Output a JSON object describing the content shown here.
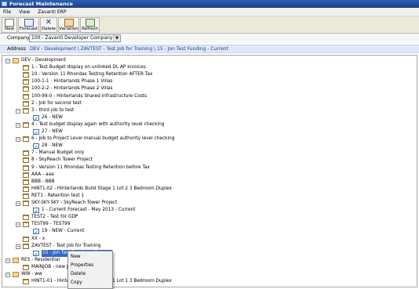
{
  "window": {
    "title": "Forecast Maintenance"
  },
  "menu": {
    "items": [
      "File",
      "View",
      "Zavanti ERP"
    ]
  },
  "toolbar": {
    "new": "New",
    "forecast": "Forecast",
    "delete": "Delete",
    "variation": "Variation",
    "refresh": "Refresh"
  },
  "company": {
    "label": "Company",
    "value": "100 - Zavanti Developer Company"
  },
  "address": {
    "label": "Address",
    "value": "DEV - Development \\ ZAVTEST - Test Job for Training \\ 15 - Jon Test Funding - Current"
  },
  "tree": [
    {
      "text": "DEV - Development",
      "level": 0,
      "exp": "-",
      "icon": "folder"
    },
    {
      "text": "1 - Test Budget display on unlinked DL AP invoices",
      "level": 1,
      "exp": "",
      "icon": "doc"
    },
    {
      "text": "10 - Version 11 Rhondas Testing Retention AFTER Tax",
      "level": 1,
      "exp": "",
      "icon": "doc"
    },
    {
      "text": "100-1-1 - Hinterlands Phase 1 Villas",
      "level": 1,
      "exp": "",
      "icon": "doc"
    },
    {
      "text": "100-2-2 - Hinterlands Phase 2 Villas",
      "level": 1,
      "exp": "",
      "icon": "doc"
    },
    {
      "text": "100-99-0 - Hinterlands Shared Infrastructure Costs",
      "level": 1,
      "exp": "",
      "icon": "doc"
    },
    {
      "text": "2 - Job for second test",
      "level": 1,
      "exp": "",
      "icon": "doc"
    },
    {
      "text": "3 - third job to test",
      "level": 1,
      "exp": "-",
      "icon": "doc"
    },
    {
      "text": "26 - NEW",
      "level": 2,
      "exp": "",
      "icon": "fc"
    },
    {
      "text": "4 - Test budget display again with authority level checking",
      "level": 1,
      "exp": "-",
      "icon": "doc"
    },
    {
      "text": "27 - NEW",
      "level": 2,
      "exp": "",
      "icon": "fc"
    },
    {
      "text": "6 - Job to Project Level manual budget authority level checking",
      "level": 1,
      "exp": "-",
      "icon": "doc"
    },
    {
      "text": "28 - NEW",
      "level": 2,
      "exp": "",
      "icon": "fc"
    },
    {
      "text": "7 - Manual Budget only",
      "level": 1,
      "exp": "",
      "icon": "doc"
    },
    {
      "text": "8 - SkyReach Tower Project",
      "level": 1,
      "exp": "",
      "icon": "doc"
    },
    {
      "text": "9 - Version 11 Rhondas Testing Retention before Tax",
      "level": 1,
      "exp": "",
      "icon": "doc"
    },
    {
      "text": "AAA - aaa",
      "level": 1,
      "exp": "",
      "icon": "doc"
    },
    {
      "text": "BBB - BBB",
      "level": 1,
      "exp": "",
      "icon": "doc"
    },
    {
      "text": "HINT1-02 - Hinterlands Build Stage 1 Lot 2 3 Bedroom Duplex",
      "level": 1,
      "exp": "",
      "icon": "doc"
    },
    {
      "text": "RET1 - Retention test 1",
      "level": 1,
      "exp": "",
      "icon": "doc"
    },
    {
      "text": "SKY-SKY-SKY - SkyReach Tower Project",
      "level": 1,
      "exp": "-",
      "icon": "doc"
    },
    {
      "text": "1 - Current Forecast - May 2013 - Current",
      "level": 2,
      "exp": "",
      "icon": "fc"
    },
    {
      "text": "TEST2 - Test for GDP",
      "level": 1,
      "exp": "",
      "icon": "doc"
    },
    {
      "text": "TEST99 - TEST99",
      "level": 1,
      "exp": "-",
      "icon": "doc"
    },
    {
      "text": "19 - NEW - Current",
      "level": 2,
      "exp": "",
      "icon": "fc"
    },
    {
      "text": "XX - x",
      "level": 1,
      "exp": "",
      "icon": "doc"
    },
    {
      "text": "ZAVTEST - Test Job for Training",
      "level": 1,
      "exp": "-",
      "icon": "doc"
    },
    {
      "text": "15 - Jon Test Funding - Current",
      "level": 2,
      "exp": "",
      "icon": "fc",
      "selected": true
    },
    {
      "text": "RES - Residential",
      "level": 0,
      "exp": "-",
      "icon": "folder"
    },
    {
      "text": "MAINJOB - new job",
      "level": 1,
      "exp": "",
      "icon": "doc"
    },
    {
      "text": "WW - ww",
      "level": 0,
      "exp": "-",
      "icon": "folder"
    },
    {
      "text": "HINT1-01 - Hinterlands Build Stage 1 Lot 1 3 Bedroom Duplex",
      "level": 1,
      "exp": "",
      "icon": "doc"
    }
  ],
  "context_menu": {
    "items": [
      "New",
      "Properties",
      "Delete",
      "Copy"
    ]
  }
}
